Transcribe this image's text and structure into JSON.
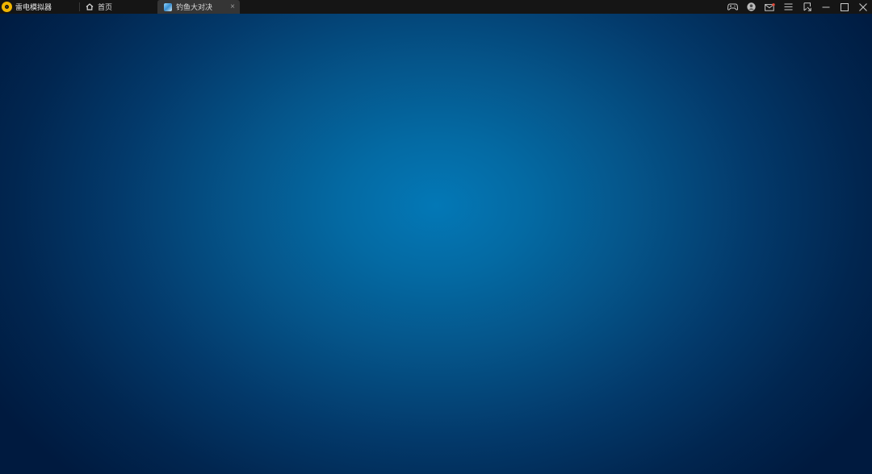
{
  "app": {
    "title": "雷电模拟器",
    "brand_color": "#f2b600"
  },
  "tabs": [
    {
      "label": "首页",
      "icon": "home-icon",
      "active": false
    },
    {
      "label": "钓鱼大对决",
      "icon": "game-thumbnail-icon",
      "active": true,
      "close_glyph": "×"
    }
  ],
  "window_controls": [
    "gamepad-icon",
    "user-avatar-icon",
    "mail-icon",
    "menu-icon",
    "sidebar-toggle-icon",
    "minimize-icon",
    "maximize-icon",
    "close-icon"
  ],
  "colors": {
    "titlebar": "#151515",
    "active_tab": "#353535",
    "stage_center": "#0378b6",
    "stage_edge": "#001a3f",
    "notification_dot": "#e84a3a"
  }
}
